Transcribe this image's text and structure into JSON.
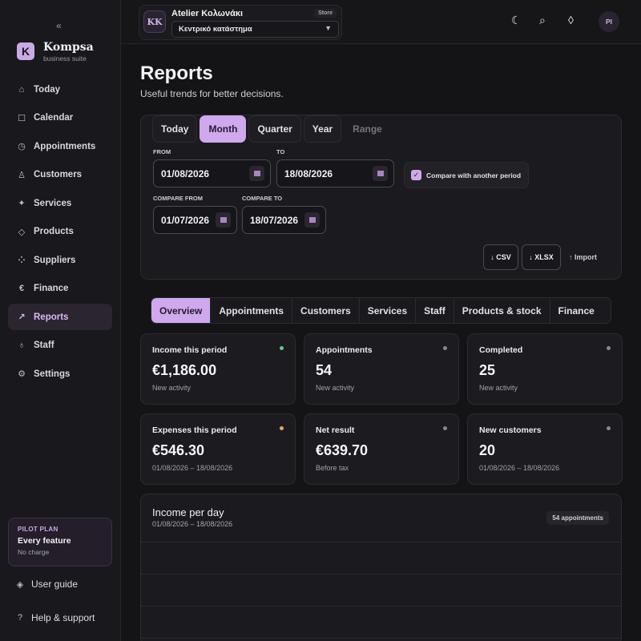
{
  "sidebar": {
    "collapse_glyph": "«",
    "logo_letter": "K",
    "brand": "Kompsa",
    "tagline": "business suite",
    "items": [
      {
        "label": "Today",
        "icon": "home-icon"
      },
      {
        "label": "Calendar",
        "icon": "calendar-icon"
      },
      {
        "label": "Appointments",
        "icon": "clock-icon"
      },
      {
        "label": "Customers",
        "icon": "person-icon"
      },
      {
        "label": "Services",
        "icon": "sparkle-icon"
      },
      {
        "label": "Products",
        "icon": "diamond-icon"
      },
      {
        "label": "Suppliers",
        "icon": "dots-icon"
      },
      {
        "label": "Finance",
        "icon": "euro-icon"
      },
      {
        "label": "Reports",
        "icon": "trend-icon",
        "active": true
      },
      {
        "label": "Staff",
        "icon": "lightbulb-icon"
      },
      {
        "label": "Settings",
        "icon": "gear-icon"
      }
    ],
    "plan": {
      "tag": "PILOT PLAN",
      "title": "Every feature",
      "sub": "No charge"
    },
    "user_guide": "User guide",
    "help": "Help & support"
  },
  "topbar": {
    "store_initials": "KK",
    "store_name": "Atelier Κολωνάκι",
    "store_badge": "Store",
    "store_location": "Κεντρικό κατάστημα",
    "user_initials": "PI"
  },
  "page": {
    "title": "Reports",
    "subtitle": "Useful trends for better decisions."
  },
  "filters": {
    "period_tabs": [
      "Today",
      "Month",
      "Quarter",
      "Year",
      "Range"
    ],
    "active_period": "Month",
    "from_label": "FROM",
    "from_value": "01/08/2026",
    "to_label": "TO",
    "to_value": "18/08/2026",
    "compare_label": "Compare with another period",
    "compare_checked": true,
    "compare_from_label": "COMPARE FROM",
    "compare_from_value": "01/07/2026",
    "compare_to_label": "COMPARE TO",
    "compare_to_value": "18/07/2026",
    "csv_label": "↓ CSV",
    "xlsx_label": "↓ XLSX",
    "import_label": "↑ Import"
  },
  "section_tabs": [
    "Overview",
    "Appointments",
    "Customers",
    "Services",
    "Staff",
    "Products & stock",
    "Finance"
  ],
  "cards": [
    {
      "title": "Income this period",
      "value": "€1,186.00",
      "sub": "New activity",
      "dot": "#5fc98f"
    },
    {
      "title": "Appointments",
      "value": "54",
      "sub": "New activity",
      "dot": "#8a898f"
    },
    {
      "title": "Completed",
      "value": "25",
      "sub": "New activity",
      "dot": "#8a898f"
    },
    {
      "title": "Expenses this period",
      "value": "€546.30",
      "sub": "01/08/2026 – 18/08/2026",
      "dot": "#e6a85a"
    },
    {
      "title": "Net result",
      "value": "€639.70",
      "sub": "Before tax",
      "dot": "#8a898f"
    },
    {
      "title": "New customers",
      "value": "20",
      "sub": "01/08/2026 – 18/08/2026",
      "dot": "#8a898f"
    }
  ],
  "chart": {
    "title": "Income per day",
    "range": "01/08/2026 – 18/08/2026",
    "badge": "54 appointments"
  },
  "colors": {
    "accent": "#cfa8ee",
    "background": "#141316"
  }
}
